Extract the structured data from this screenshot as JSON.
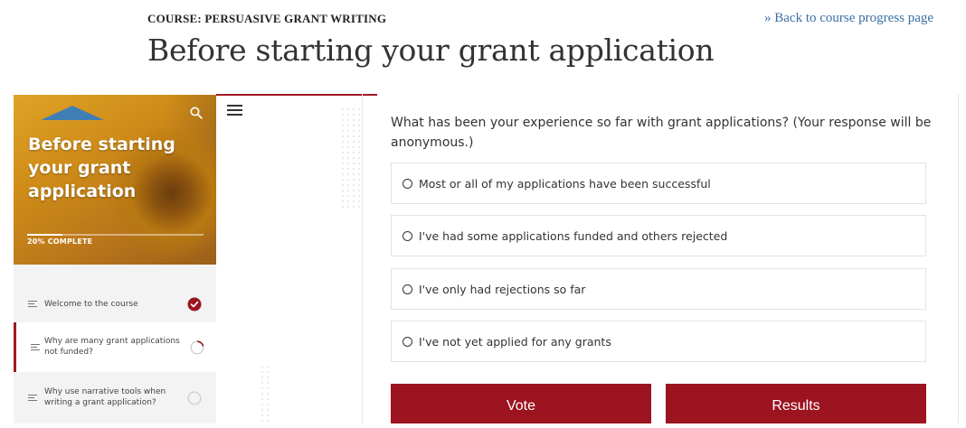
{
  "header": {
    "course_label": "COURSE: PERSUASIVE GRANT WRITING",
    "back_link": "» Back to course progress page",
    "title": "Before starting your grant application"
  },
  "sidebar": {
    "hero_title": "Before starting your grant application",
    "progress_text": "20% COMPLETE",
    "progress_fraction": 0.2,
    "lessons": [
      {
        "label": "Welcome to the course",
        "status": "complete",
        "icon": "check-circle-icon"
      },
      {
        "label": "Why are many grant applications not funded?",
        "status": "in-progress",
        "icon": "partial-progress-icon"
      },
      {
        "label": "Why use narrative tools when writing a grant application?",
        "status": "not-started",
        "icon": "empty-circle-icon"
      }
    ]
  },
  "poll": {
    "question": "What has been your experience so far with grant applications? (Your response will be anonymous.)",
    "options": [
      "Most or all of my applications have been successful",
      "I've had some applications funded and others rejected",
      "I've only had rejections so far",
      "I've not yet applied for any grants"
    ],
    "vote_label": "Vote",
    "results_label": "Results"
  },
  "colors": {
    "accent": "#9b1420",
    "link": "#3a6ea5",
    "sidebar_bg": "#f3f3f3"
  }
}
